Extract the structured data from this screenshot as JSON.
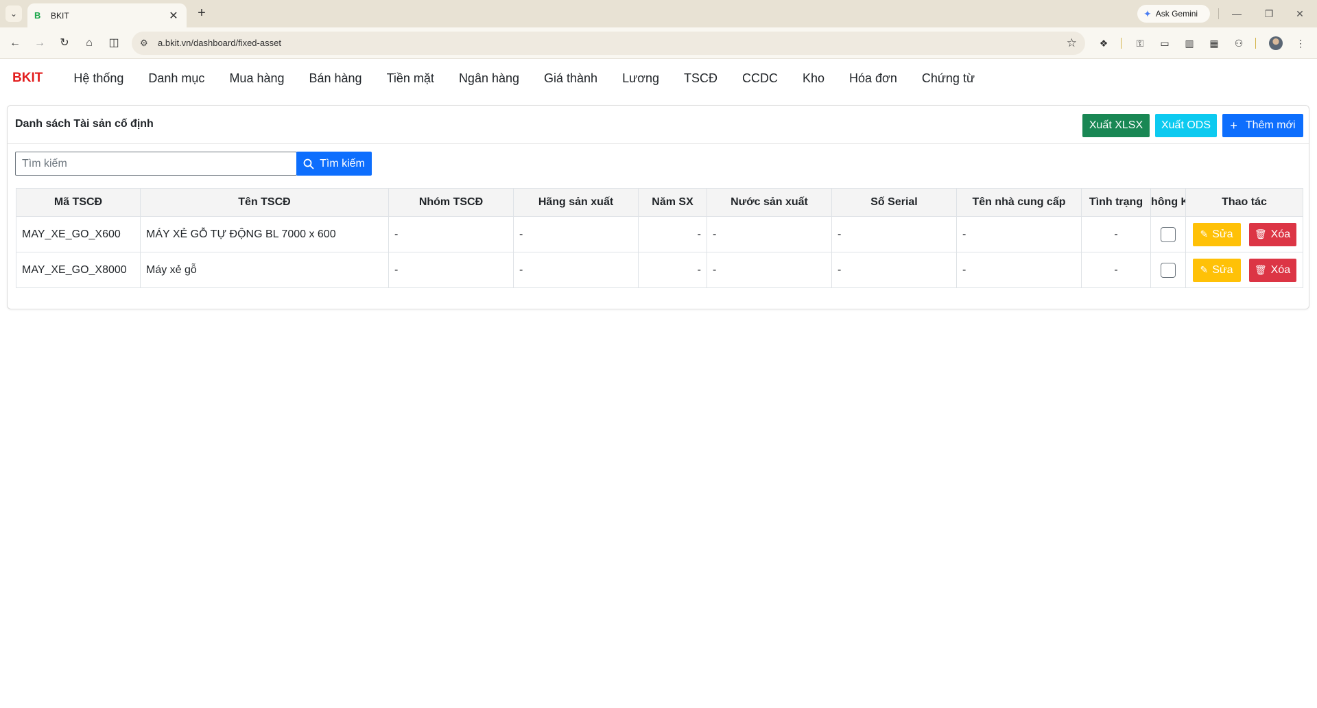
{
  "browser": {
    "tab_title": "BKIT",
    "tab_favicon": "B",
    "url": "a.bkit.vn/dashboard/fixed-asset",
    "gemini_label": "Ask Gemini"
  },
  "app": {
    "brand": "BKIT",
    "nav": [
      "Hệ thống",
      "Danh mục",
      "Mua hàng",
      "Bán hàng",
      "Tiền mặt",
      "Ngân hàng",
      "Giá thành",
      "Lương",
      "TSCĐ",
      "CCDC",
      "Kho",
      "Hóa đơn",
      "Chứng từ"
    ]
  },
  "page": {
    "title": "Danh sách Tài sản cố định",
    "export_xlsx_label": "Xuất XLSX",
    "export_ods_label": "Xuất ODS",
    "add_label": "Thêm mới",
    "search_placeholder": "Tìm kiếm",
    "search_button_label": "Tìm kiếm"
  },
  "table": {
    "columns": [
      "Mã TSCĐ",
      "Tên TSCĐ",
      "Nhóm TSCĐ",
      "Hãng sản xuất",
      "Năm SX",
      "Nước sản xuất",
      "Số Serial",
      "Tên nhà cung cấp",
      "Tình trạng",
      "hông K",
      "Thao tác"
    ],
    "rows": [
      {
        "code": "MAY_XE_GO_X600",
        "name": "MÁY XẺ GỖ TỰ ĐỘNG BL 7000 x 600",
        "group": "-",
        "manufacturer": "-",
        "year": "-",
        "country": "-",
        "serial": "-",
        "supplier": "-",
        "status": "-",
        "checked": false
      },
      {
        "code": "MAY_XE_GO_X8000",
        "name": "Máy xẻ gỗ",
        "group": "-",
        "manufacturer": "-",
        "year": "-",
        "country": "-",
        "serial": "-",
        "supplier": "-",
        "status": "-",
        "checked": false
      }
    ],
    "edit_label": "Sửa",
    "delete_label": "Xóa"
  },
  "colors": {
    "brand": "#e21d1d",
    "success": "#198754",
    "info": "#0dcaf0",
    "primary": "#0d6efd",
    "warning": "#ffc107",
    "danger": "#dc3545"
  }
}
